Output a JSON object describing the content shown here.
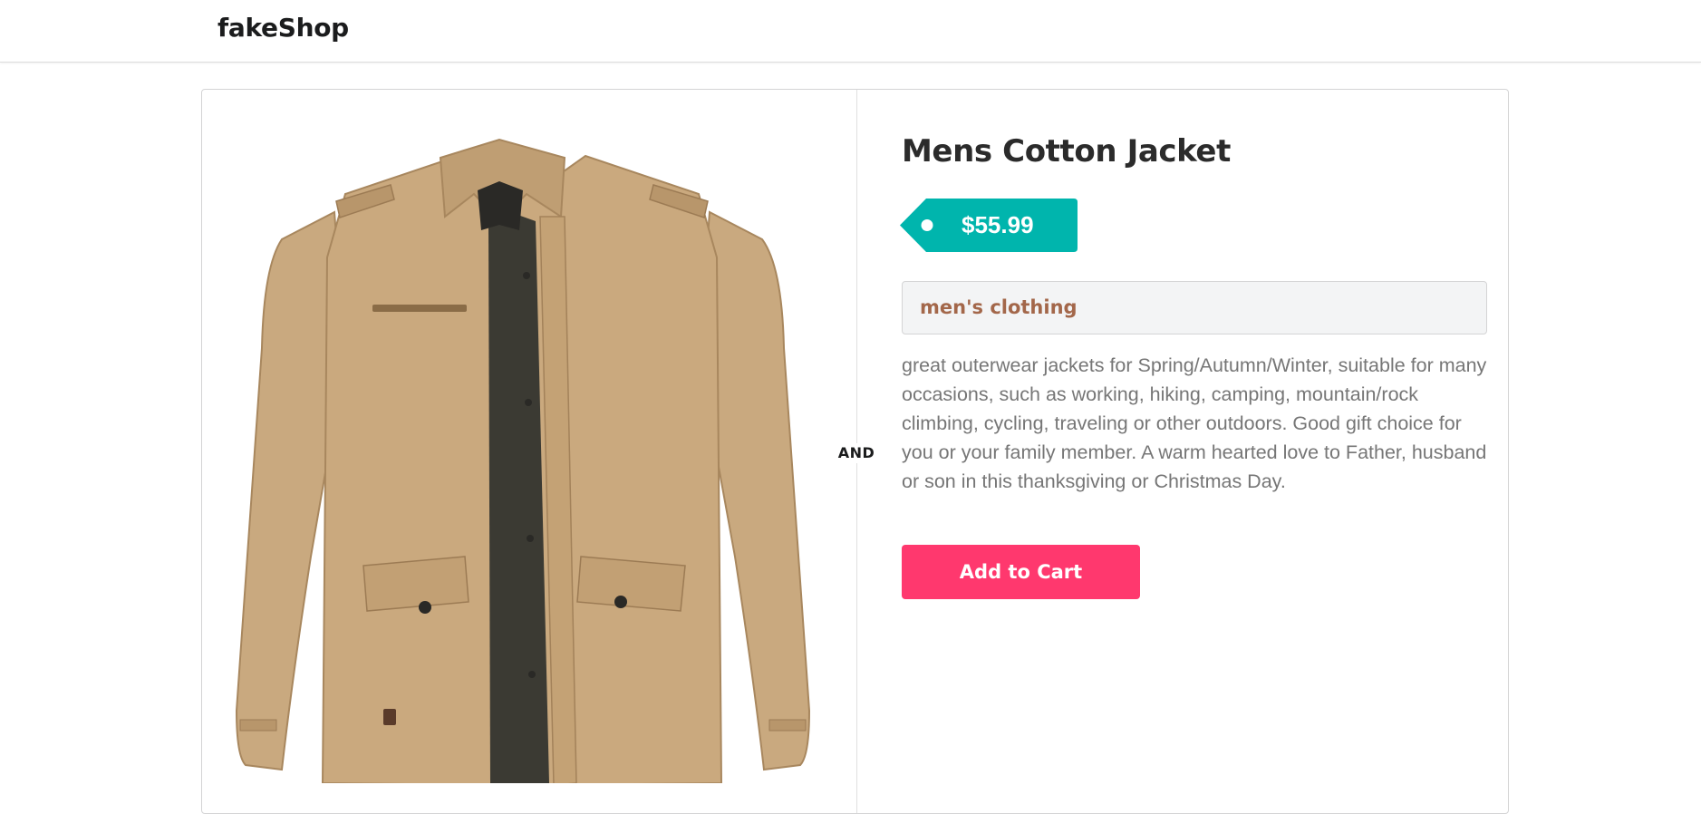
{
  "header": {
    "brand": "fakeShop"
  },
  "product": {
    "title": "Mens Cotton Jacket",
    "price": "$55.99",
    "category": "men's clothing",
    "description": "great outerwear jackets for Spring/Autumn/Winter, suitable for many occasions, such as working, hiking, camping, mountain/rock climbing, cycling, traveling or other outdoors. Good gift choice for you or your family member. A warm hearted love to Father, husband or son in this thanksgiving or Christmas Day.",
    "image_alt": "Mens Cotton Jacket"
  },
  "divider": {
    "label": "AND"
  },
  "actions": {
    "add_to_cart_label": "Add to Cart"
  },
  "colors": {
    "price_tag": "#00b5ad",
    "category_text": "#a3674a",
    "cart_button": "#ff386e",
    "jacket": "#c9a97f"
  }
}
